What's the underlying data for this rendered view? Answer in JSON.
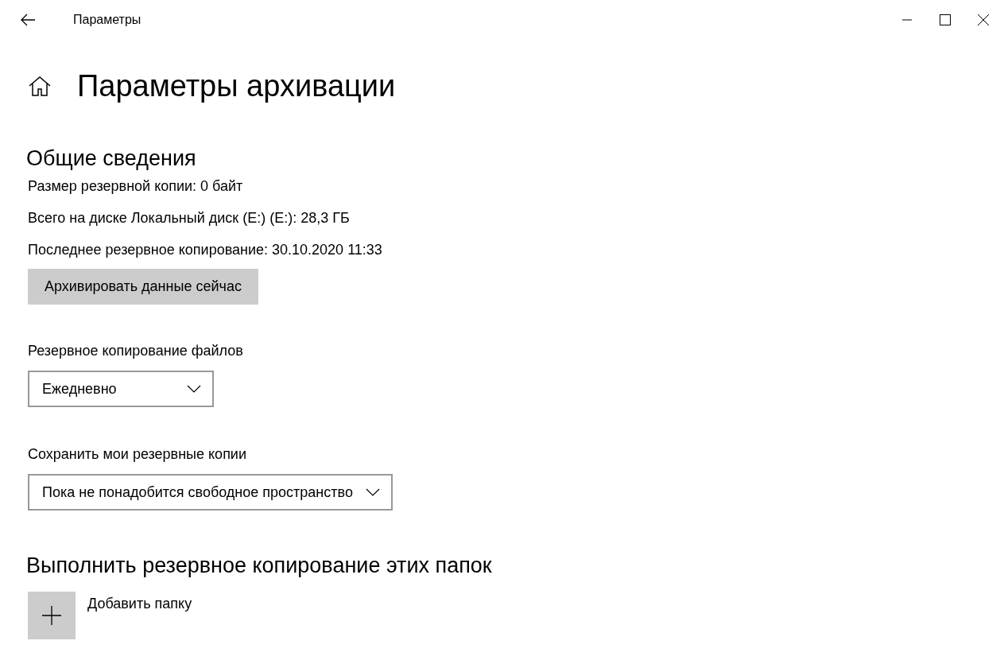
{
  "window": {
    "title": "Параметры"
  },
  "page_title": "Параметры архивации",
  "overview": {
    "heading": "Общие сведения",
    "lines": [
      "Размер резервной копии: 0 байт",
      "Всего на диске Локальный диск (E:) (E:): 28,3 ГБ",
      "Последнее резервное копирование: 30.10.2020 11:33"
    ],
    "button": "Архивировать данные сейчас"
  },
  "settings": [
    {
      "label": "Резервное копирование файлов",
      "value": "Ежедневно"
    },
    {
      "label": "Сохранить мои резервные копии",
      "value": "Пока не понадобится свободное пространство"
    }
  ],
  "folders": {
    "heading": "Выполнить резервное копирование этих папок",
    "add_label": "Добавить папку"
  }
}
